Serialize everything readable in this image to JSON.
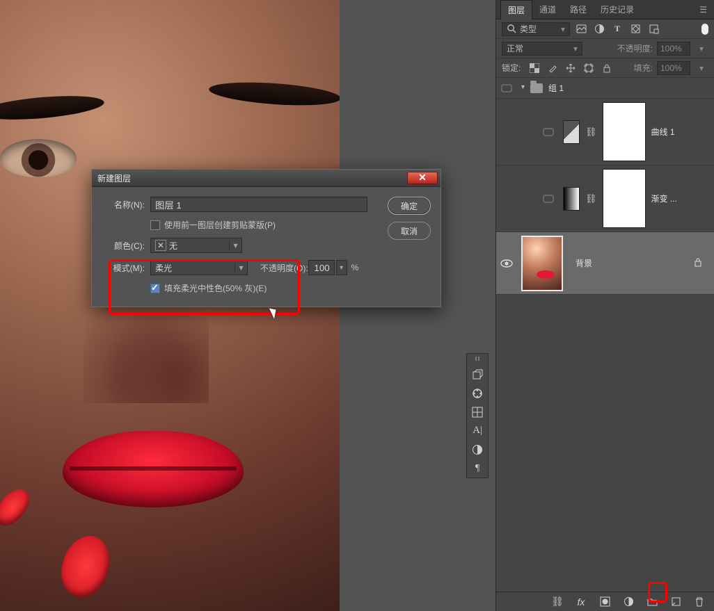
{
  "panel": {
    "tabs": [
      "图层",
      "通道",
      "路径",
      "历史记录"
    ],
    "activeTab": 0,
    "filterKind": "类型",
    "blendMode": "正常",
    "opacityLabel": "不透明度:",
    "opacityValue": "100%",
    "lockLabel": "锁定:",
    "fillLabel": "填充:",
    "fillValue": "100%",
    "layers": {
      "group": {
        "name": "组 1",
        "expanded": true
      },
      "curves": {
        "name": "曲线 1"
      },
      "gradientMap": {
        "name": "渐变 ..."
      },
      "background": {
        "name": "背景"
      }
    }
  },
  "dialog": {
    "title": "新建图层",
    "nameLabel": "名称(N):",
    "nameValue": "图层 1",
    "clipMaskLabel": "使用前一图层创建剪贴蒙版(P)",
    "colorLabel": "颜色(C):",
    "colorValue": "无",
    "modeLabel": "模式(M):",
    "modeValue": "柔光",
    "opacityLabel": "不透明度(O):",
    "opacityValue": "100",
    "opacityPct": "%",
    "fillNeutralLabel": "填充柔光中性色(50% 灰)(E)",
    "ok": "确定",
    "cancel": "取消"
  }
}
